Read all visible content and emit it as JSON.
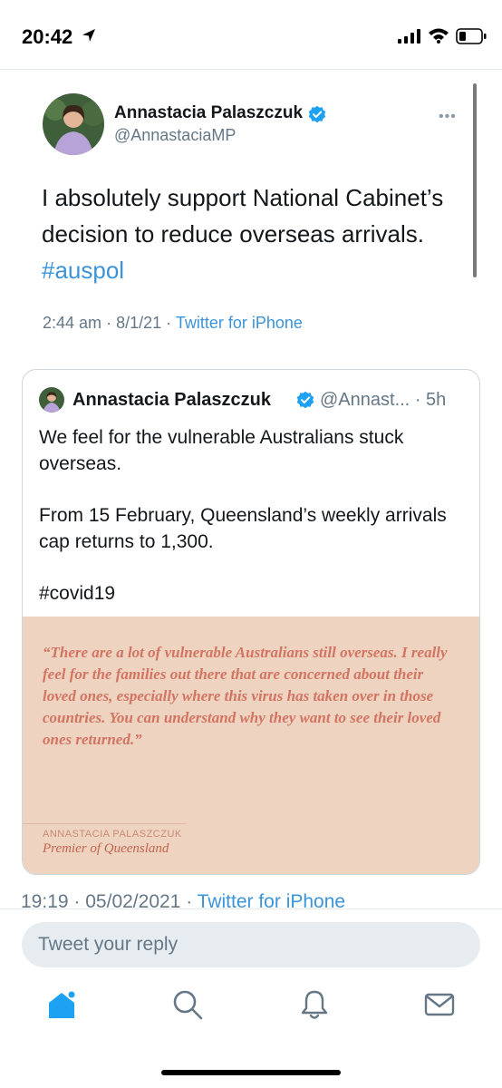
{
  "status_bar": {
    "time": "20:42",
    "icons": [
      "location-arrow-icon",
      "signal-icon",
      "wifi-icon",
      "battery-icon"
    ]
  },
  "tweet": {
    "author_name": "Annastacia Palaszczuk",
    "author_handle": "@AnnastaciaMP",
    "text": "I absolutely support National Cabinet’s decision to reduce overseas arrivals.",
    "hashtag": "#auspol",
    "time": "2:44 am",
    "date": "8/1/21",
    "source": "Twitter for iPhone"
  },
  "quoted_tweet": {
    "author_name": "Annastacia Palaszczuk",
    "author_handle": "@Annast...",
    "age": "5h",
    "paragraphs": [
      "We feel for the vulnerable Australians stuck overseas.",
      "From 15 February, Queensland’s weekly arrivals cap returns to 1,300.",
      "#covid19"
    ],
    "image": {
      "quote": "“There are a lot of vulnerable Australians still overseas. I really feel for the families out there that are concerned about their loved ones, especially where this virus has taken over in those countries. You can understand why they want to see their loved ones returned.”",
      "attribution_name": "ANNASTACIA PALASZCZUK",
      "attribution_title": "Premier of Queensland"
    }
  },
  "secondary_meta": {
    "time": "19:19",
    "date": "05/02/2021",
    "source": "Twitter for iPhone"
  },
  "reply": {
    "placeholder": "Tweet your reply"
  },
  "tab_bar": [
    "home-icon",
    "search-icon",
    "notifications-icon",
    "messages-icon"
  ],
  "colors": {
    "accent": "#1DA1F2",
    "link": "#3B94D9",
    "muted": "#657786",
    "quote_bg": "#EED3C1",
    "quote_text": "#D27461"
  }
}
